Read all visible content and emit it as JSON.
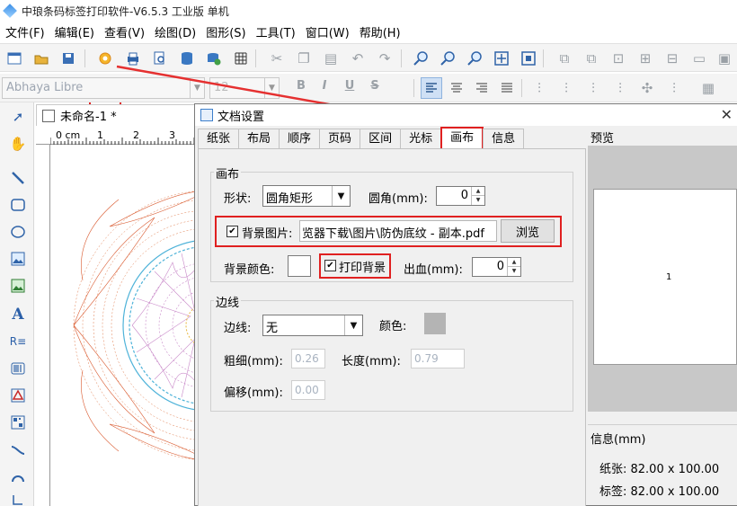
{
  "app": {
    "title": "中琅条码标签打印软件-V6.5.3 工业版 单机"
  },
  "menu": {
    "items": [
      {
        "label": "文件(F)"
      },
      {
        "label": "编辑(E)"
      },
      {
        "label": "查看(V)"
      },
      {
        "label": "绘图(D)"
      },
      {
        "label": "图形(S)"
      },
      {
        "label": "工具(T)"
      },
      {
        "label": "窗口(W)"
      },
      {
        "label": "帮助(H)"
      }
    ]
  },
  "font_toolbar": {
    "font_name": "Abhaya Libre",
    "font_size": "12",
    "bold": "B",
    "italic": "I",
    "underline": "U",
    "strike": "S"
  },
  "document": {
    "tab_label": "未命名-1 *",
    "ruler_label_1": "0 cm",
    "ruler_label_2": "1",
    "ruler_label_3": "2",
    "ruler_label_4": "3"
  },
  "dialog": {
    "title": "文档设置",
    "tabs": [
      {
        "label": "纸张"
      },
      {
        "label": "布局"
      },
      {
        "label": "顺序"
      },
      {
        "label": "页码"
      },
      {
        "label": "区间"
      },
      {
        "label": "光标"
      },
      {
        "label": "画布"
      },
      {
        "label": "信息"
      }
    ],
    "canvas_group": {
      "title": "画布",
      "shape_label": "形状:",
      "shape_value": "圆角矩形",
      "radius_label": "圆角(mm):",
      "radius_value": "0",
      "bg_image_label": "背景图片:",
      "bg_image_path": "览器下载\\图片\\防伪底纹 - 副本.pdf",
      "browse_label": "浏览",
      "bg_color_label": "背景颜色:",
      "print_bg_label": "打印背景",
      "bleed_label": "出血(mm):",
      "bleed_value": "0"
    },
    "border_group": {
      "title": "边线",
      "border_label": "边线:",
      "border_value": "无",
      "color_label": "颜色:",
      "thickness_label": "粗细(mm):",
      "thickness_value": "0.26",
      "length_label": "长度(mm):",
      "length_value": "0.79",
      "offset_label": "偏移(mm):",
      "offset_value": "0.00"
    },
    "preview": {
      "title": "预览",
      "page_number": "1"
    },
    "info": {
      "title": "信息(mm)",
      "paper": "纸张: 82.00 x 100.00",
      "label": "标签: 82.00 x 100.00"
    }
  },
  "colors": {
    "highlight_red": "#e02020",
    "border_swatch": "#b4b4b4"
  }
}
